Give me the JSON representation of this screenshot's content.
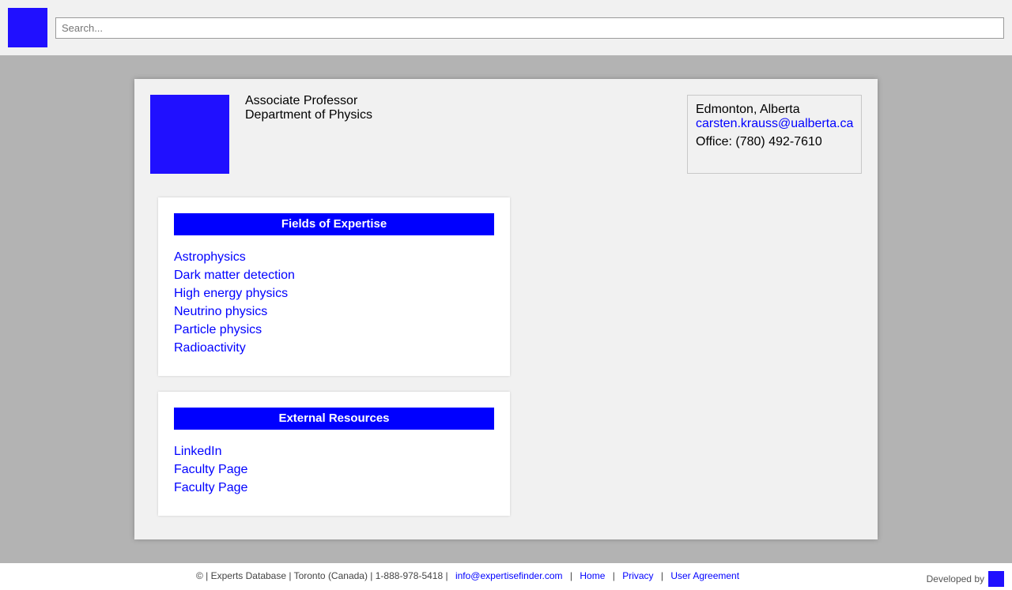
{
  "header": {
    "search_placeholder": "Search..."
  },
  "profile": {
    "position": "Associate Professor",
    "department": "Department of Physics",
    "location": "Edmonton, Alberta",
    "email": "carsten.krauss@ualberta.ca",
    "phone": "Office: (780) 492-7610"
  },
  "expertise": {
    "heading": "Fields of Expertise",
    "items": [
      "Astrophysics",
      "Dark matter detection",
      "High energy physics",
      "Neutrino physics",
      "Particle physics",
      "Radioactivity"
    ]
  },
  "resources": {
    "heading": "External Resources",
    "items": [
      "LinkedIn",
      "Faculty Page",
      "Faculty Page"
    ]
  },
  "footer": {
    "info": "© | Experts Database | Toronto (Canada) | 1-888-978-5418 |",
    "email": "info@expertisefinder.com",
    "home": "Home",
    "privacy": "Privacy",
    "agreement": "User Agreement",
    "developed_by": "Developed by"
  },
  "colors": {
    "accent": "#0000ff",
    "logo": "#2010ff"
  }
}
